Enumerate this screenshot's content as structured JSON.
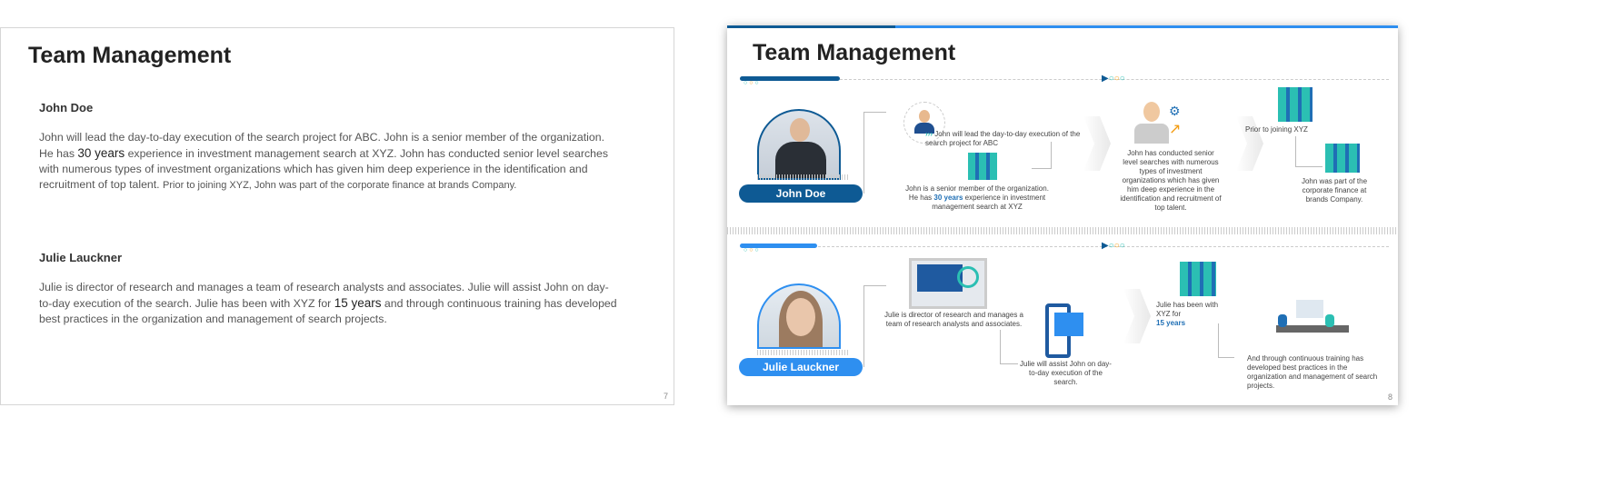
{
  "slide7": {
    "title": "Team Management",
    "page_number": "7",
    "people": [
      {
        "name": "John Doe",
        "p1": "John will lead the day-to-day execution of the search project for ABC. John is  a senior member of the organization. He has ",
        "years": "30 years",
        "p2": " experience in investment management search at XYZ. John has conducted senior level searches with numerous types of investment organizations which has given him deep experience in the identification and recruitment of top talent. ",
        "p3": "Prior to joining XYZ, John was part of the corporate finance at brands Company."
      },
      {
        "name": "Julie Lauckner",
        "p1": "Julie is director of research and manages a team of research analysts and associates. Julie will assist John on day-to-day execution of the search. Julie has been with XYZ for ",
        "years": "15 years",
        "p2": " and through continuous training has developed best practices in the organization and management of search projects."
      }
    ]
  },
  "slide8": {
    "title": "Team Management",
    "page_number": "8",
    "colors": {
      "john": "#0e5a94",
      "julie": "#2e8ff0",
      "teal": "#2bbfb3",
      "orange": "#f39c12"
    },
    "john": {
      "name": "John Doe",
      "t1": "John will lead the day-to-day  execution of the search project for ABC",
      "t2a": "John is  a senior member of the organization.  He has ",
      "t2b": "30 years",
      "t2c": " experience  in investment management  search at XYZ",
      "t3": "John has conducted senior level searches with numerous types of investment organizations which has given him deep experience in the identification and recruitment of top talent.",
      "t4": "Prior to joining XYZ",
      "t5": "John was part of the corporate finance at brands Company."
    },
    "julie": {
      "name": "Julie Lauckner",
      "t1": "Julie is director of research and manages a team of research analysts and associates.",
      "t2": "Julie will assist John on day-to-day execution of the search.",
      "t3a": "Julie has been with XYZ for",
      "t3b": "15 years",
      "t4": "And through continuous training has developed  best practices in the organization and management of search projects."
    }
  }
}
